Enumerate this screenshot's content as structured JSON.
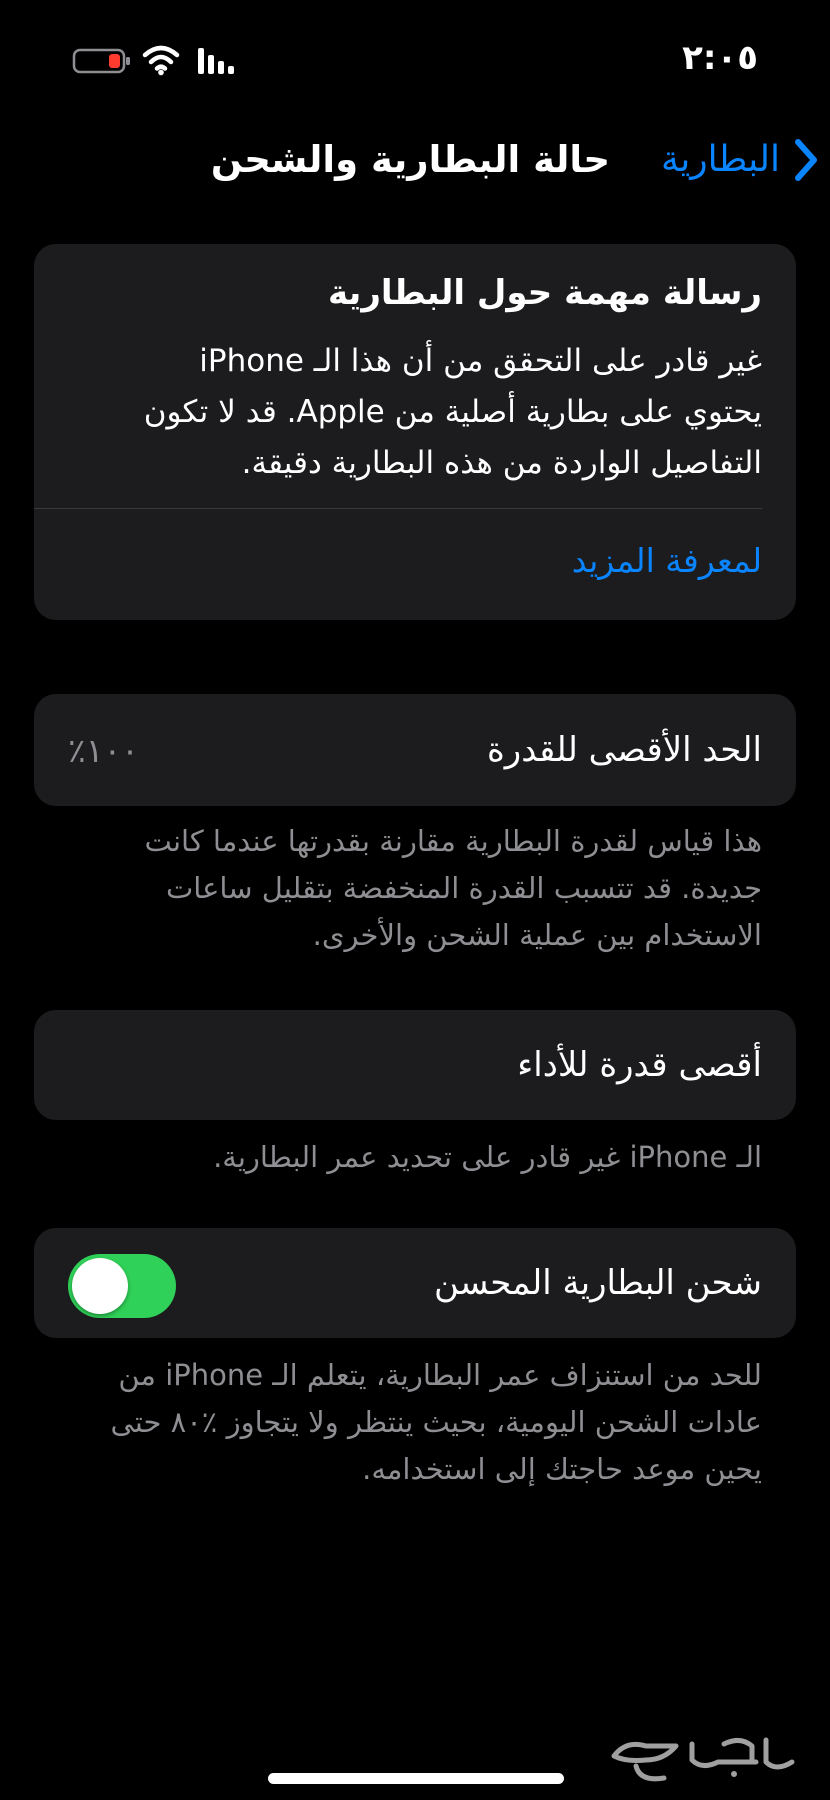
{
  "status_bar": {
    "time": "٢:٠٥",
    "battery_icon": "battery-low-icon",
    "wifi_icon": "wifi-icon",
    "signal_icon": "cellular-signal-icon",
    "battery_color": "#ff3b30"
  },
  "nav": {
    "back_label": "البطارية",
    "back_icon": "chevron-left-icon",
    "title": "حالة البطارية والشحن"
  },
  "alert_card": {
    "title": "رسالة مهمة حول البطارية",
    "body_lines": [
      "غير قادر على التحقق من أن هذا الـ iPhone",
      "يحتوي على بطارية أصلية من Apple. قد لا تكون",
      "التفاصيل الواردة من هذه البطارية دقيقة."
    ],
    "link_label": "لمعرفة المزيد"
  },
  "maximum_capacity": {
    "label": "الحد الأقصى للقدرة",
    "value": "٪١٠٠",
    "footnote_lines": [
      "هذا قياس لقدرة البطارية مقارنة بقدرتها عندما كانت",
      "جديدة. قد تتسبب القدرة المنخفضة بتقليل ساعات",
      "الاستخدام بين عملية الشحن والأخرى."
    ]
  },
  "peak_performance": {
    "label": "أقصى قدرة للأداء",
    "footnote": "الـ iPhone غير قادر على تحديد عمر البطارية."
  },
  "optimized_charging": {
    "label": "شحن البطارية المحسن",
    "enabled": true,
    "footnote_lines": [
      "للحد من استنزاف عمر البطارية، يتعلم الـ iPhone من",
      "عادات الشحن اليومية، بحيث ينتظر ولا يتجاوز ٪٨٠ حتى",
      "يحين موعد حاجتك إلى استخدامه."
    ]
  },
  "watermark": {
    "text": "حراج"
  },
  "colors": {
    "accent": "#0a84ff",
    "card_bg": "#1c1c1e",
    "secondary_text": "#8e8e93",
    "toggle_on": "#30d158"
  }
}
